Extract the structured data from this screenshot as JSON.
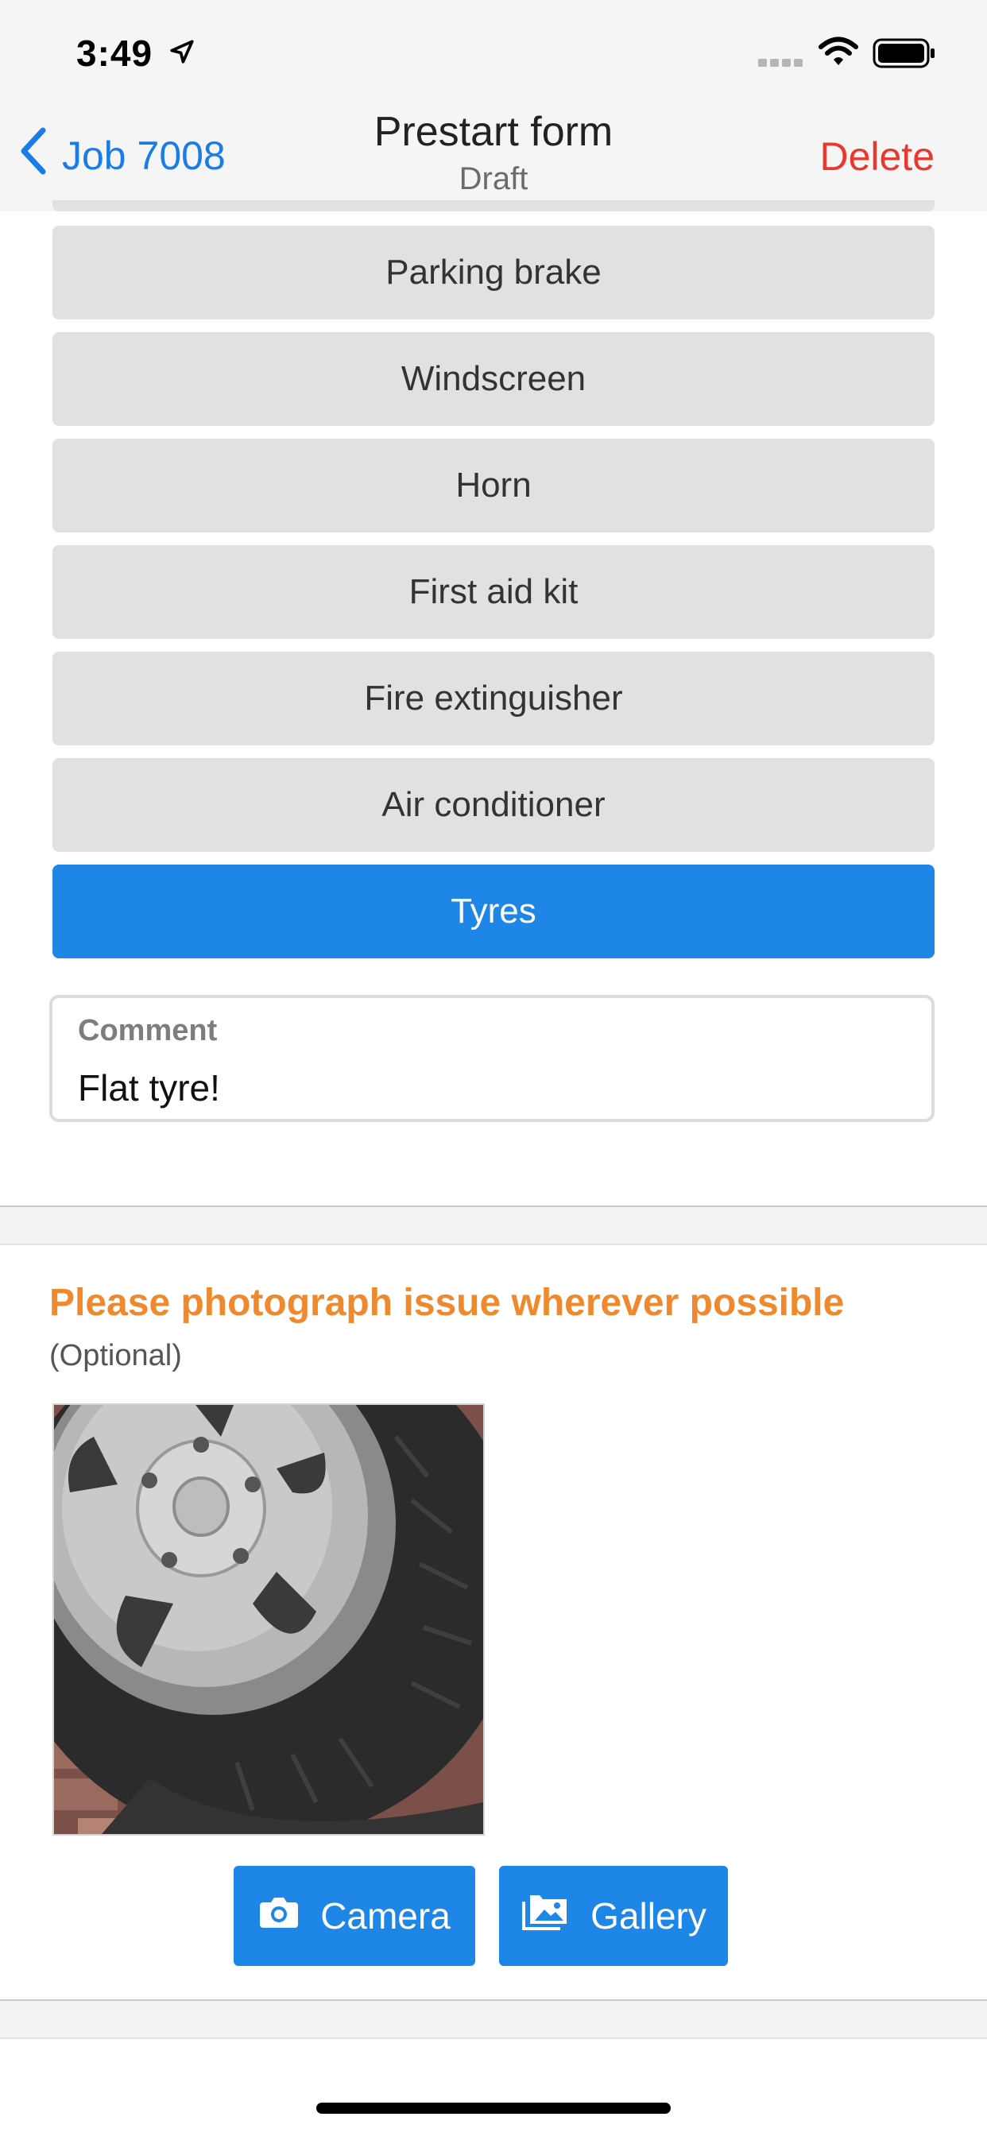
{
  "status_bar": {
    "time": "3:49"
  },
  "nav": {
    "back_label": "Job 7008",
    "title": "Prestart form",
    "subtitle": "Draft",
    "delete_label": "Delete"
  },
  "options": [
    {
      "label": "Parking brake",
      "selected": false
    },
    {
      "label": "Windscreen",
      "selected": false
    },
    {
      "label": "Horn",
      "selected": false
    },
    {
      "label": "First aid kit",
      "selected": false
    },
    {
      "label": "Fire extinguisher",
      "selected": false
    },
    {
      "label": "Air conditioner",
      "selected": false
    },
    {
      "label": "Tyres",
      "selected": true
    }
  ],
  "comment": {
    "label": "Comment",
    "value": "Flat tyre!"
  },
  "photo_section": {
    "title": "Please photograph issue wherever possible",
    "subtitle": "(Optional)",
    "camera_label": "Camera",
    "gallery_label": "Gallery"
  },
  "colors": {
    "accent_blue": "#1e86e6",
    "link_blue": "#1a7ce6",
    "delete_red": "#e8392f",
    "prompt_orange": "#f0892e",
    "option_grey": "#e1e1e1"
  },
  "icons": [
    "location-arrow-icon",
    "signal-icon",
    "wifi-icon",
    "battery-icon",
    "chevron-left-icon",
    "camera-icon",
    "gallery-icon"
  ]
}
